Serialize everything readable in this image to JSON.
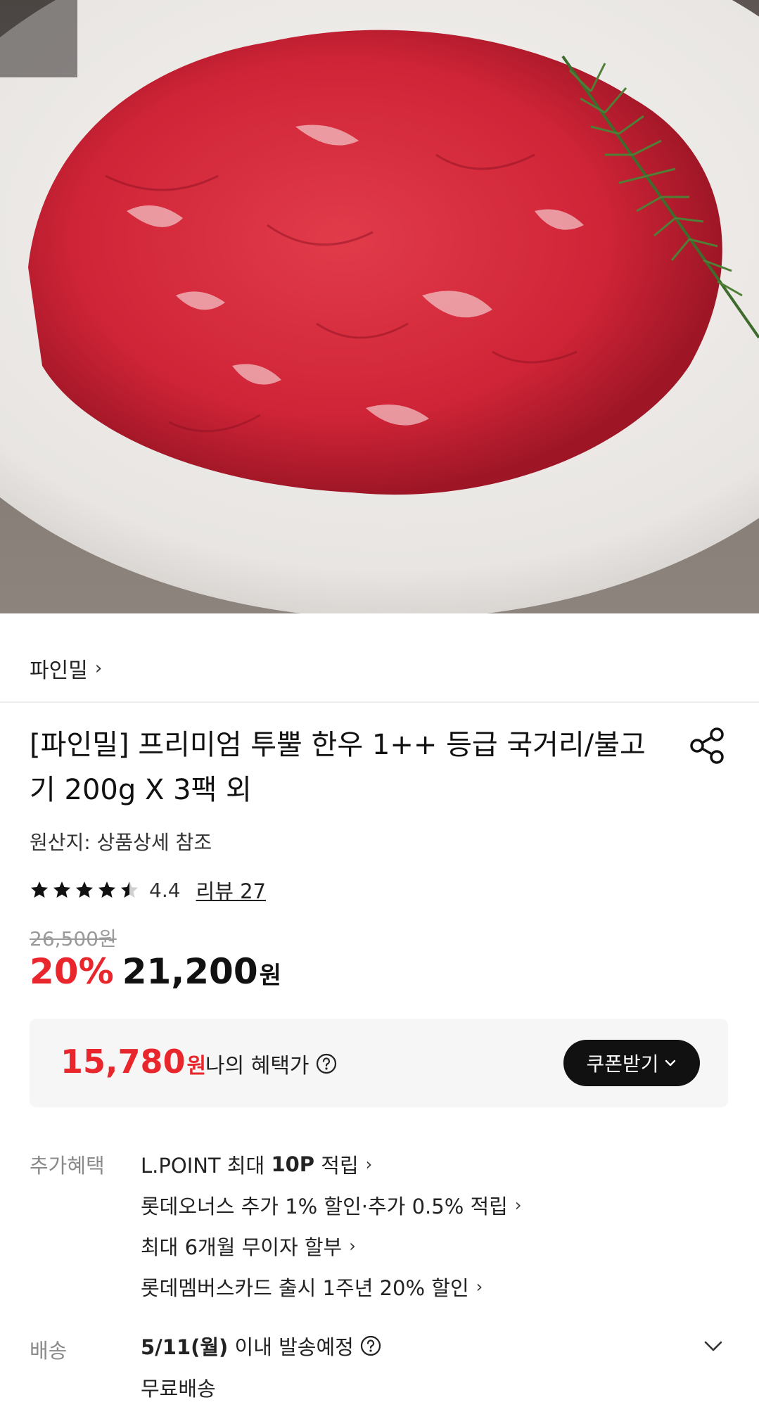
{
  "gallery": {
    "progress": 0.2
  },
  "seller": {
    "name": "파인밀",
    "chevron": "›"
  },
  "product": {
    "title_line1": "[파인밀] 프리미엄 투뿔 한우 1++ 등급 국거리/불고",
    "title_line2": "기 200g X 3팩 외",
    "origin": "원산지: 상품상세 참조",
    "rating": {
      "value": "4.4",
      "stars": 4.5,
      "review_label": "리뷰 27"
    },
    "original_price": "26,500원",
    "discount": "20%",
    "price": "21,200",
    "price_unit": "원"
  },
  "benefit": {
    "price": "15,780",
    "unit": "원",
    "label": "나의 혜택가",
    "coupon_button": "쿠폰받기"
  },
  "extra": {
    "label": "추가혜택",
    "items": [
      {
        "pre": "L.POINT 최대 ",
        "bold": "10P",
        "post": " 적립"
      },
      {
        "pre": "롯데오너스 추가 1% 할인·추가 0.5% 적립",
        "bold": "",
        "post": ""
      },
      {
        "pre": "최대 6개월 무이자 할부",
        "bold": "",
        "post": ""
      },
      {
        "pre": "롯데멤버스카드 출시 1주년 20% 할인",
        "bold": "",
        "post": ""
      }
    ]
  },
  "shipping": {
    "label": "배송",
    "date": "5/11(월)",
    "date_suffix": " 이내 발송예정",
    "fee": "무료배송"
  },
  "icons": [
    "share-icon",
    "help-icon",
    "chevron-down-icon",
    "star-icon",
    "product-image"
  ],
  "colors": {
    "accent": "#e8262c",
    "dark": "#111111",
    "muted": "#8a8a8a"
  }
}
